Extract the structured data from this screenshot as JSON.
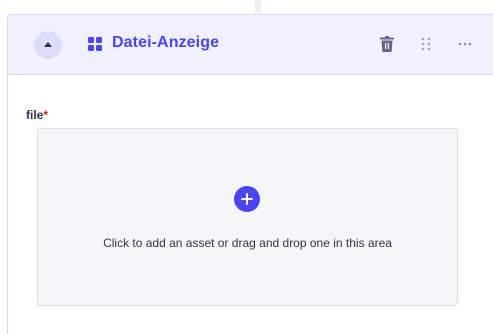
{
  "component": {
    "title": "Datei-Anzeige",
    "accent_color": "#4945ff",
    "icons": {
      "collapse": "chevron-up-icon",
      "component": "grid-icon",
      "delete": "trash-icon",
      "drag": "drag-handle-icon",
      "more": "more-icon"
    }
  },
  "field": {
    "label": "file",
    "required_mark": "*",
    "required_color": "#d02b20"
  },
  "dropzone": {
    "text": "Click to add an asset or drag and drop one in this area",
    "icon": "plus-circle-icon"
  }
}
